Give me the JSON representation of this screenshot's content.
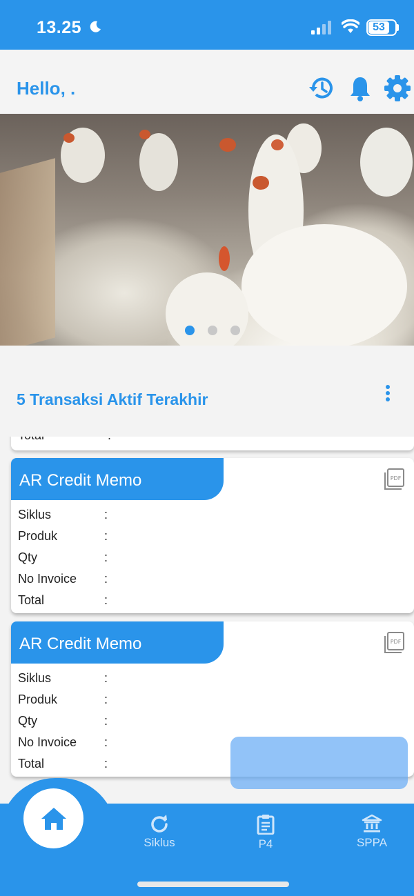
{
  "status_bar": {
    "time": "13.25",
    "battery": "53"
  },
  "header": {
    "greeting": "Hello, ."
  },
  "banner": {
    "slides": 3,
    "active_slide": 1
  },
  "section": {
    "title": "5 Transaksi Aktif Terakhir"
  },
  "previous_card": {
    "total_label": "Total",
    "colon": ":"
  },
  "cards": [
    {
      "title": "AR Credit Memo",
      "rows": [
        {
          "label": "Siklus",
          "colon": ":"
        },
        {
          "label": "Produk",
          "colon": ":"
        },
        {
          "label": "Qty",
          "colon": ":"
        },
        {
          "label": "No Invoice",
          "colon": ":"
        },
        {
          "label": "Total",
          "colon": ":"
        }
      ]
    },
    {
      "title": "AR Credit Memo",
      "rows": [
        {
          "label": "Siklus",
          "colon": ":"
        },
        {
          "label": "Produk",
          "colon": ":"
        },
        {
          "label": "Qty",
          "colon": ":"
        },
        {
          "label": "No Invoice",
          "colon": ":"
        },
        {
          "label": "Total",
          "colon": ":"
        }
      ]
    }
  ],
  "bottom_nav": {
    "items": [
      {
        "label": "Siklus",
        "icon": "refresh-icon"
      },
      {
        "label": "P4",
        "icon": "clipboard-icon"
      },
      {
        "label": "SPPA",
        "icon": "bank-icon"
      }
    ],
    "home_icon": "home-icon"
  },
  "colors": {
    "primary": "#2a94ea",
    "background": "#f3f3f3"
  }
}
